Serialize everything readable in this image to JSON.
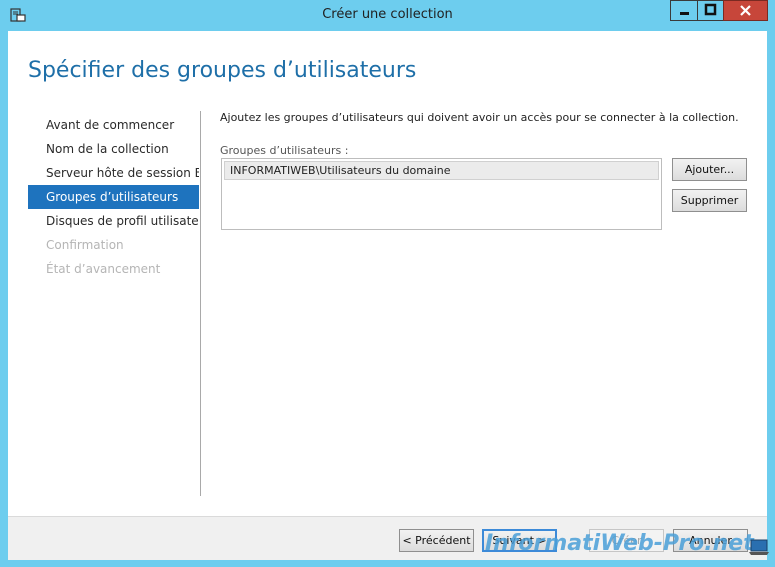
{
  "window": {
    "title": "Créer une collection",
    "close_color": "#c7463a",
    "titlebar_color": "#6dcdee"
  },
  "page": {
    "heading": "Spécifier des groupes d’utilisateurs",
    "instruction": "Ajoutez les groupes d’utilisateurs qui doivent avoir un accès pour se connecter à la collection.",
    "groups_label": "Groupes d’utilisateurs :",
    "groups": [
      "INFORMATIWEB\\Utilisateurs du domaine"
    ],
    "add_label": "Ajouter...",
    "remove_label": "Supprimer"
  },
  "nav": {
    "items": [
      {
        "label": "Avant de commencer"
      },
      {
        "label": "Nom de la collection"
      },
      {
        "label": "Serveur hôte de session B..."
      },
      {
        "label": "Groupes d’utilisateurs"
      },
      {
        "label": "Disques de profil utilisateur"
      },
      {
        "label": "Confirmation"
      },
      {
        "label": "État d’avancement"
      }
    ],
    "accent": "#1e73be"
  },
  "footer": {
    "prev_label": "< Précédent",
    "next_label": "Suivant >",
    "create_label": "Créer",
    "cancel_label": "Annuler"
  },
  "watermark": {
    "text": "InformatiWeb-Pro.net"
  }
}
